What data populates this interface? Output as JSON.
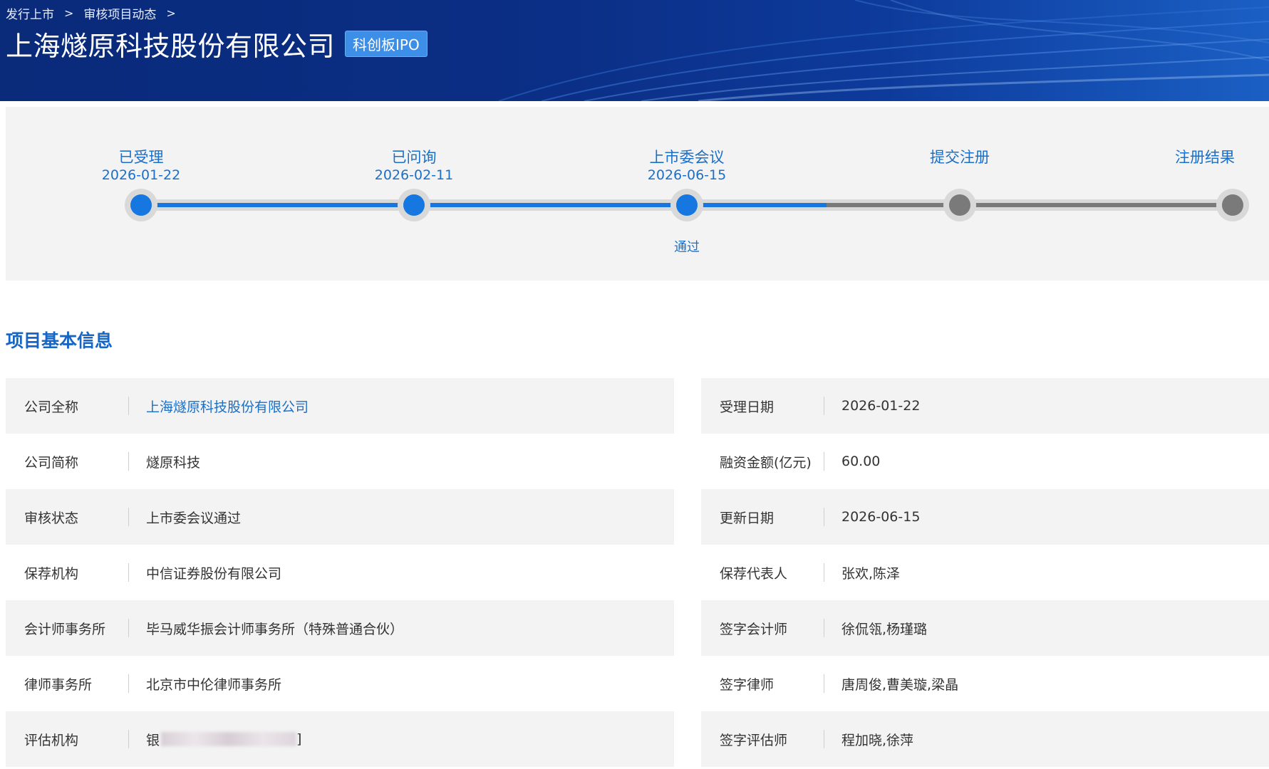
{
  "breadcrumb": [
    {
      "label": "发行上市"
    },
    {
      "label": "审核项目动态"
    }
  ],
  "breadcrumb_separator": ">",
  "header": {
    "title": "上海燧原科技股份有限公司",
    "badge": "科创板IPO"
  },
  "progress": {
    "steps": [
      {
        "label": "已受理",
        "date": "2026-01-22",
        "status": "done"
      },
      {
        "label": "已问询",
        "date": "2026-02-11",
        "status": "done"
      },
      {
        "label": "上市委会议",
        "date": "2026-06-15",
        "status": "done",
        "result": "通过"
      },
      {
        "label": "提交注册",
        "date": "",
        "status": "todo"
      },
      {
        "label": "注册结果",
        "date": "",
        "status": "todo"
      }
    ],
    "colors": {
      "done": "#1677e0",
      "todo": "#7a7a7a",
      "track": "#d9d9d9"
    }
  },
  "section": {
    "title": "项目基本信息"
  },
  "info": {
    "rows": [
      {
        "left_label": "公司全称",
        "left_value": "上海燧原科技股份有限公司",
        "right_label": "受理日期",
        "right_value": "2026-01-22"
      },
      {
        "left_label": "公司简称",
        "left_value": "燧原科技",
        "right_label": "融资金额(亿元)",
        "right_value": "60.00"
      },
      {
        "left_label": "审核状态",
        "left_value": "上市委会议通过",
        "right_label": "更新日期",
        "right_value": "2026-06-15"
      },
      {
        "left_label": "保荐机构",
        "left_value": "中信证券股份有限公司",
        "right_label": "保荐代表人",
        "right_value": "张欢,陈泽"
      },
      {
        "left_label": "会计师事务所",
        "left_value": "毕马威华振会计师事务所（特殊普通合伙）",
        "right_label": "签字会计师",
        "right_value": "徐侃瓴,杨瑾璐"
      },
      {
        "left_label": "律师事务所",
        "left_value": "北京市中伦律师事务所",
        "right_label": "签字律师",
        "right_value": "唐周俊,曹美璇,梁晶"
      },
      {
        "left_label": "评估机构",
        "left_value": "银",
        "left_value_end": "]",
        "right_label": "签字评估师",
        "right_value": "程加晓,徐萍"
      }
    ]
  }
}
